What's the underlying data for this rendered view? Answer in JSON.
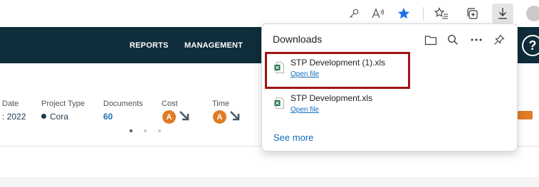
{
  "toolbar": {
    "icons": [
      "key-icon",
      "read-aloud-icon",
      "favorite-star-icon",
      "favorites-list-icon",
      "collections-icon",
      "downloads-icon",
      "profile-avatar"
    ],
    "colors": {
      "star": "#1a73e8"
    }
  },
  "app": {
    "nav": {
      "reports": "REPORTS",
      "management": "MANAGEMENT"
    },
    "help_label": "?",
    "colors": {
      "header_bg": "#0f2d3a",
      "badge": "#e07b26",
      "link": "#1b6fb8"
    },
    "stats": {
      "date_label": "Date",
      "date_value": ": 2022",
      "project_type_label": "Project Type",
      "project_type_value": "Cora",
      "documents_label": "Documents",
      "documents_value": "60",
      "cost_label": "Cost",
      "cost_badge": "A",
      "time_label": "Time",
      "time_badge": "A"
    },
    "pager": {
      "count": 3,
      "active": 1
    }
  },
  "downloads": {
    "title": "Downloads",
    "icons": [
      "folder-icon",
      "search-icon",
      "more-icon",
      "pin-icon"
    ],
    "items": [
      {
        "name": "STP Development (1).xls",
        "link": "Open file",
        "highlighted": true
      },
      {
        "name": "STP Development.xls",
        "link": "Open file",
        "highlighted": false
      }
    ],
    "see_more": "See more"
  }
}
